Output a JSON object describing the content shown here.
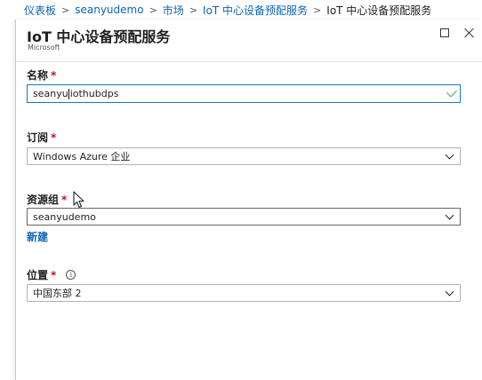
{
  "breadcrumb": {
    "items": [
      "仪表板",
      "seanyudemo",
      "市场",
      "IoT 中心设备预配服务"
    ],
    "current": "IoT 中心设备预配服务",
    "separator": ">"
  },
  "blade": {
    "title": "IoT 中心设备预配服务",
    "subtitle": "Microsoft"
  },
  "form": {
    "name": {
      "label": "名称",
      "required": "*",
      "value_before_caret": "seanyu",
      "value_after_caret": "iothubdps",
      "valid": true
    },
    "subscription": {
      "label": "订阅",
      "required": "*",
      "selected": "Windows Azure 企业"
    },
    "resource_group": {
      "label": "资源组",
      "required": "*",
      "selected": "seanyudemo",
      "create_new": "新建"
    },
    "location": {
      "label": "位置",
      "required": "*",
      "info": "i",
      "selected": "中国东部 2"
    }
  },
  "colors": {
    "link": "#0a65b4",
    "focus_border": "#1b76c4",
    "required": "#c50f1f",
    "valid_check": "#4da04d"
  }
}
